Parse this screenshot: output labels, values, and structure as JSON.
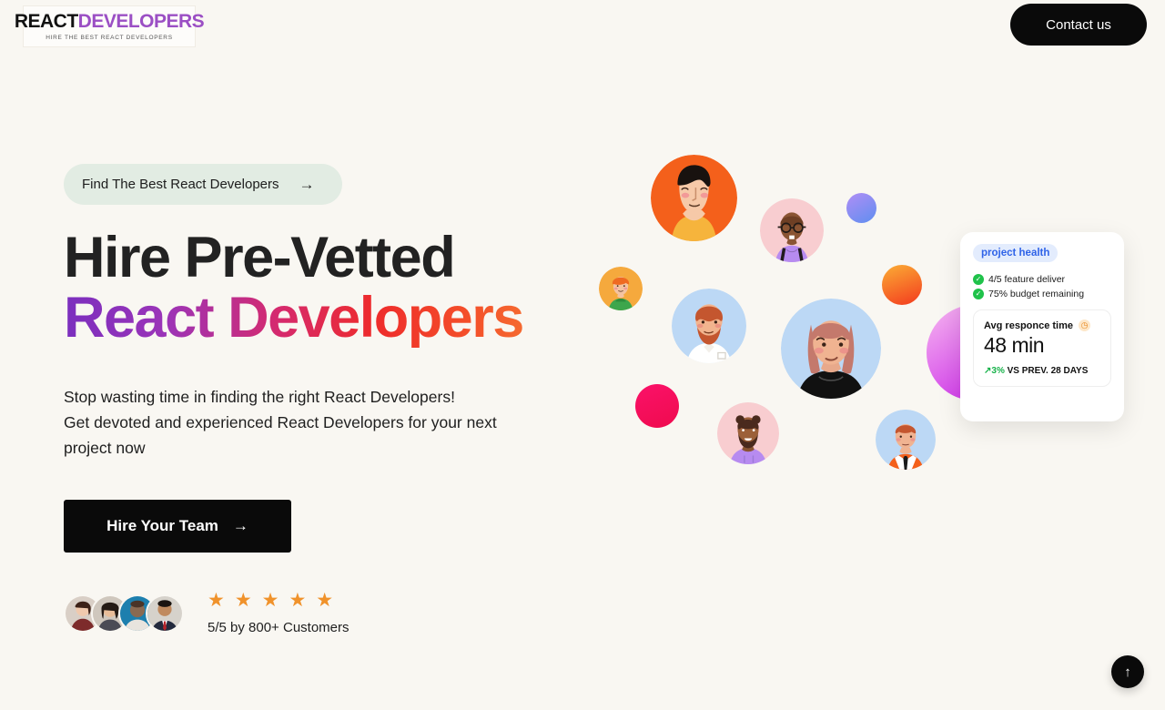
{
  "header": {
    "logo": {
      "part1": "REACT",
      "part2": "DEVELOPERS",
      "tagline": "HIRE THE BEST REACT DEVELOPERS"
    },
    "contact_label": "Contact us"
  },
  "hero": {
    "pill_label": "Find The Best React Developers",
    "pill_arrow": "→",
    "heading_line1": "Hire Pre-Vetted",
    "heading_line2": "React Developers",
    "subtext_line1": "Stop wasting time in finding the right React Developers!",
    "subtext_line2": "Get devoted and experienced React Developers for your next",
    "subtext_line3": "project now",
    "cta_label": "Hire Your Team",
    "cta_arrow": "→",
    "stars": "★★★★★",
    "rating_text": "5/5 by 800+ Customers"
  },
  "card": {
    "badge": "project health",
    "checks": [
      {
        "text": "4/5 feature deliver",
        "icon": "check-icon"
      },
      {
        "text": "75% budget remaining",
        "icon": "check-icon"
      }
    ],
    "metric_label": "Avg responce time",
    "metric_icon": "clock-icon",
    "metric_value": "48 min",
    "metric_delta": "3%",
    "metric_delta_suffix": " VS PREV. 28 DAYS",
    "metric_delta_arrow": "↗"
  },
  "scroll_top": {
    "icon": "arrow-up-icon",
    "glyph": "↑"
  },
  "colors": {
    "page_bg": "#f9f7f2",
    "accent_purple": "#7b2fbe",
    "accent_orange": "#f79b3c",
    "badge_bg": "#e3ecfd",
    "badge_text": "#2f63e8",
    "pill_bg": "#e2ece3",
    "success_green": "#1fc24a",
    "star_orange": "#f0922b",
    "button_black": "#0a0a0a"
  },
  "illustration": {
    "avatars": [
      {
        "name": "avatar-orange-yellow-shirt",
        "bg": "#f4601b"
      },
      {
        "name": "avatar-pink-glasses-suspenders",
        "bg": "#f8cdd0"
      },
      {
        "name": "avatar-small-orange-green-shirt",
        "bg": "#f5a93d"
      },
      {
        "name": "avatar-blue-bearded-white-shirt",
        "bg": "#bcd8f5"
      },
      {
        "name": "avatar-blue-woman-black-top",
        "bg": "#bcd8f5"
      },
      {
        "name": "avatar-pink-purple-hoodie",
        "bg": "#f8cdd0"
      },
      {
        "name": "avatar-blue-orange-jacket-tie",
        "bg": "#bcd8f5"
      }
    ],
    "balls": [
      {
        "name": "ball-periwinkle",
        "color": "#7d8ef0"
      },
      {
        "name": "ball-orange-gradient",
        "color": "#f97316"
      },
      {
        "name": "ball-pink-solid",
        "color": "#f2115f"
      },
      {
        "name": "ball-magenta-gradient",
        "color": "#d926e8"
      }
    ]
  }
}
